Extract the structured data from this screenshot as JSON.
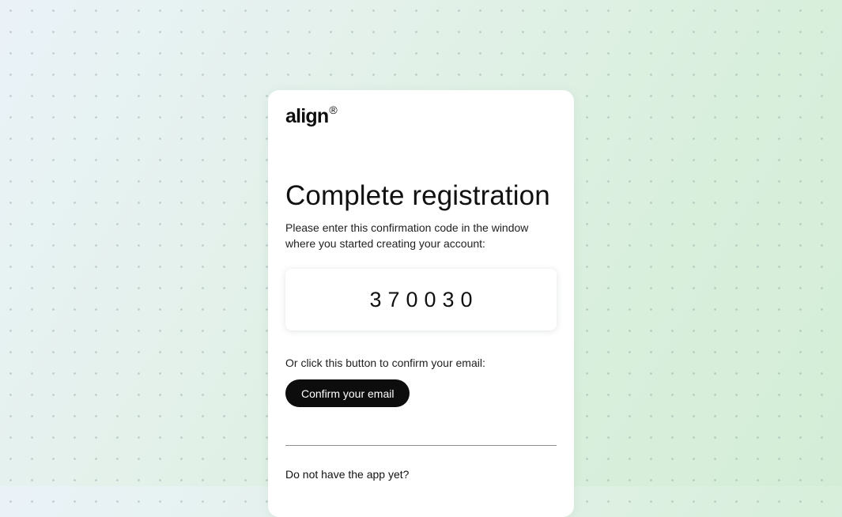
{
  "logo": {
    "text": "align",
    "mark": "®"
  },
  "registration": {
    "title": "Complete registration",
    "description": "Please enter this confirmation code in the window where you started creating your account:",
    "code": "370030",
    "alt_prompt": "Or click this button to confirm your email:",
    "confirm_label": "Confirm your email",
    "app_prompt": "Do not have the app yet?"
  },
  "colors": {
    "button_bg": "#0d0d0d",
    "button_text": "#ffffff",
    "card_bg": "#ffffff"
  }
}
